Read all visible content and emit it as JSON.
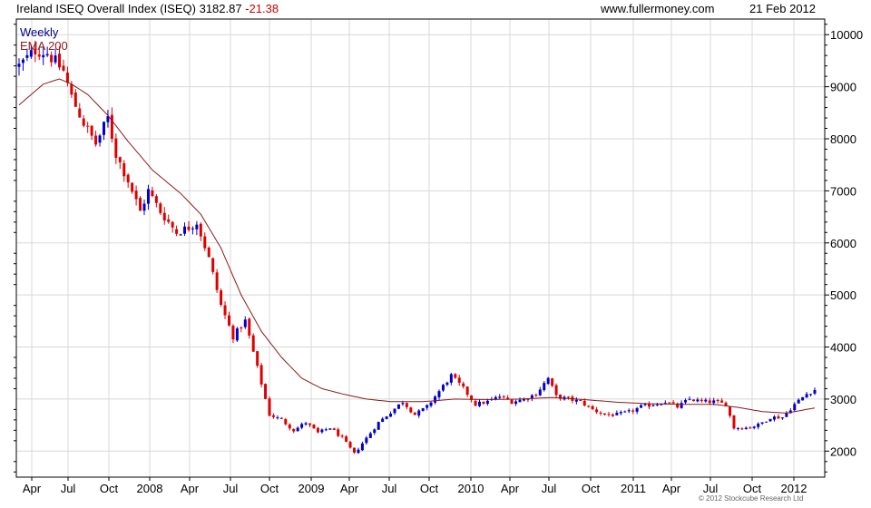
{
  "header": {
    "title": "Ireland ISEQ Overall Index (ISEQ)",
    "last": "3182.87",
    "change": "-21.38",
    "site": "www.fullermoney.com",
    "date": "21 Feb 2012"
  },
  "footer": {
    "copyright": "© 2012 Stockcube Research Ltd"
  },
  "colors": {
    "up": "#0000cc",
    "down": "#dd0000",
    "ema": "#8b1a1a",
    "grid": "#d8d8d8",
    "axis": "#000000"
  },
  "chart_data": {
    "type": "candlestick",
    "frequency": "Weekly",
    "legend": [
      {
        "name": "Weekly",
        "color": "#00008b"
      },
      {
        "name": "EMA 200",
        "color": "#8b1a1a"
      }
    ],
    "legend_position": "top-left",
    "grid": true,
    "ylim": [
      1500,
      10300
    ],
    "y_ticks": [
      2000,
      3000,
      4000,
      5000,
      6000,
      7000,
      8000,
      9000,
      10000
    ],
    "x_ticks": [
      "Apr",
      "Jul",
      "Oct",
      "2008",
      "Apr",
      "Jul",
      "Oct",
      "2009",
      "Apr",
      "Jul",
      "Oct",
      "2010",
      "Apr",
      "Jul",
      "Oct",
      "2011",
      "Apr",
      "Jul",
      "Oct",
      "2012"
    ],
    "close_path": [
      [
        0,
        9400
      ],
      [
        4,
        9700
      ],
      [
        7,
        9650
      ],
      [
        11,
        9300
      ],
      [
        13,
        8800
      ],
      [
        16,
        8300
      ],
      [
        19,
        7900
      ],
      [
        22,
        8400
      ],
      [
        24,
        7700
      ],
      [
        27,
        7200
      ],
      [
        30,
        6600
      ],
      [
        32,
        7000
      ],
      [
        35,
        6600
      ],
      [
        39,
        6200
      ],
      [
        42,
        6300
      ],
      [
        44,
        6400
      ],
      [
        47,
        5700
      ],
      [
        50,
        4800
      ],
      [
        53,
        4200
      ],
      [
        56,
        4500
      ],
      [
        59,
        3600
      ],
      [
        62,
        2700
      ],
      [
        65,
        2600
      ],
      [
        68,
        2400
      ],
      [
        71,
        2550
      ],
      [
        74,
        2350
      ],
      [
        77,
        2450
      ],
      [
        80,
        2250
      ],
      [
        83,
        1950
      ],
      [
        86,
        2250
      ],
      [
        89,
        2550
      ],
      [
        92,
        2750
      ],
      [
        95,
        2950
      ],
      [
        98,
        2700
      ],
      [
        101,
        2850
      ],
      [
        104,
        3150
      ],
      [
        107,
        3450
      ],
      [
        110,
        3200
      ],
      [
        113,
        2900
      ],
      [
        116,
        2950
      ],
      [
        119,
        3050
      ],
      [
        122,
        2950
      ],
      [
        125,
        3000
      ],
      [
        128,
        3100
      ],
      [
        131,
        3400
      ],
      [
        133,
        3050
      ],
      [
        136,
        3000
      ],
      [
        139,
        2950
      ],
      [
        142,
        2800
      ],
      [
        145,
        2700
      ],
      [
        148,
        2700
      ],
      [
        151,
        2750
      ],
      [
        154,
        2850
      ],
      [
        157,
        2900
      ],
      [
        160,
        2950
      ],
      [
        163,
        2850
      ],
      [
        166,
        3000
      ],
      [
        169,
        2950
      ],
      [
        172,
        2950
      ],
      [
        175,
        2900
      ],
      [
        177,
        2450
      ],
      [
        180,
        2450
      ],
      [
        183,
        2500
      ],
      [
        186,
        2650
      ],
      [
        189,
        2650
      ],
      [
        192,
        2900
      ],
      [
        195,
        3100
      ],
      [
        197,
        3180
      ]
    ],
    "ema_path": [
      [
        0,
        8650
      ],
      [
        6,
        9050
      ],
      [
        10,
        9150
      ],
      [
        13,
        9050
      ],
      [
        17,
        8850
      ],
      [
        22,
        8450
      ],
      [
        27,
        7950
      ],
      [
        33,
        7400
      ],
      [
        40,
        6950
      ],
      [
        45,
        6550
      ],
      [
        50,
        5900
      ],
      [
        55,
        5000
      ],
      [
        60,
        4300
      ],
      [
        65,
        3800
      ],
      [
        70,
        3400
      ],
      [
        75,
        3200
      ],
      [
        80,
        3100
      ],
      [
        86,
        3000
      ],
      [
        92,
        2950
      ],
      [
        100,
        2950
      ],
      [
        108,
        3000
      ],
      [
        116,
        2990
      ],
      [
        124,
        3000
      ],
      [
        132,
        3030
      ],
      [
        140,
        2990
      ],
      [
        148,
        2940
      ],
      [
        156,
        2910
      ],
      [
        164,
        2900
      ],
      [
        172,
        2900
      ],
      [
        178,
        2840
      ],
      [
        184,
        2760
      ],
      [
        190,
        2730
      ],
      [
        197,
        2830
      ]
    ]
  }
}
